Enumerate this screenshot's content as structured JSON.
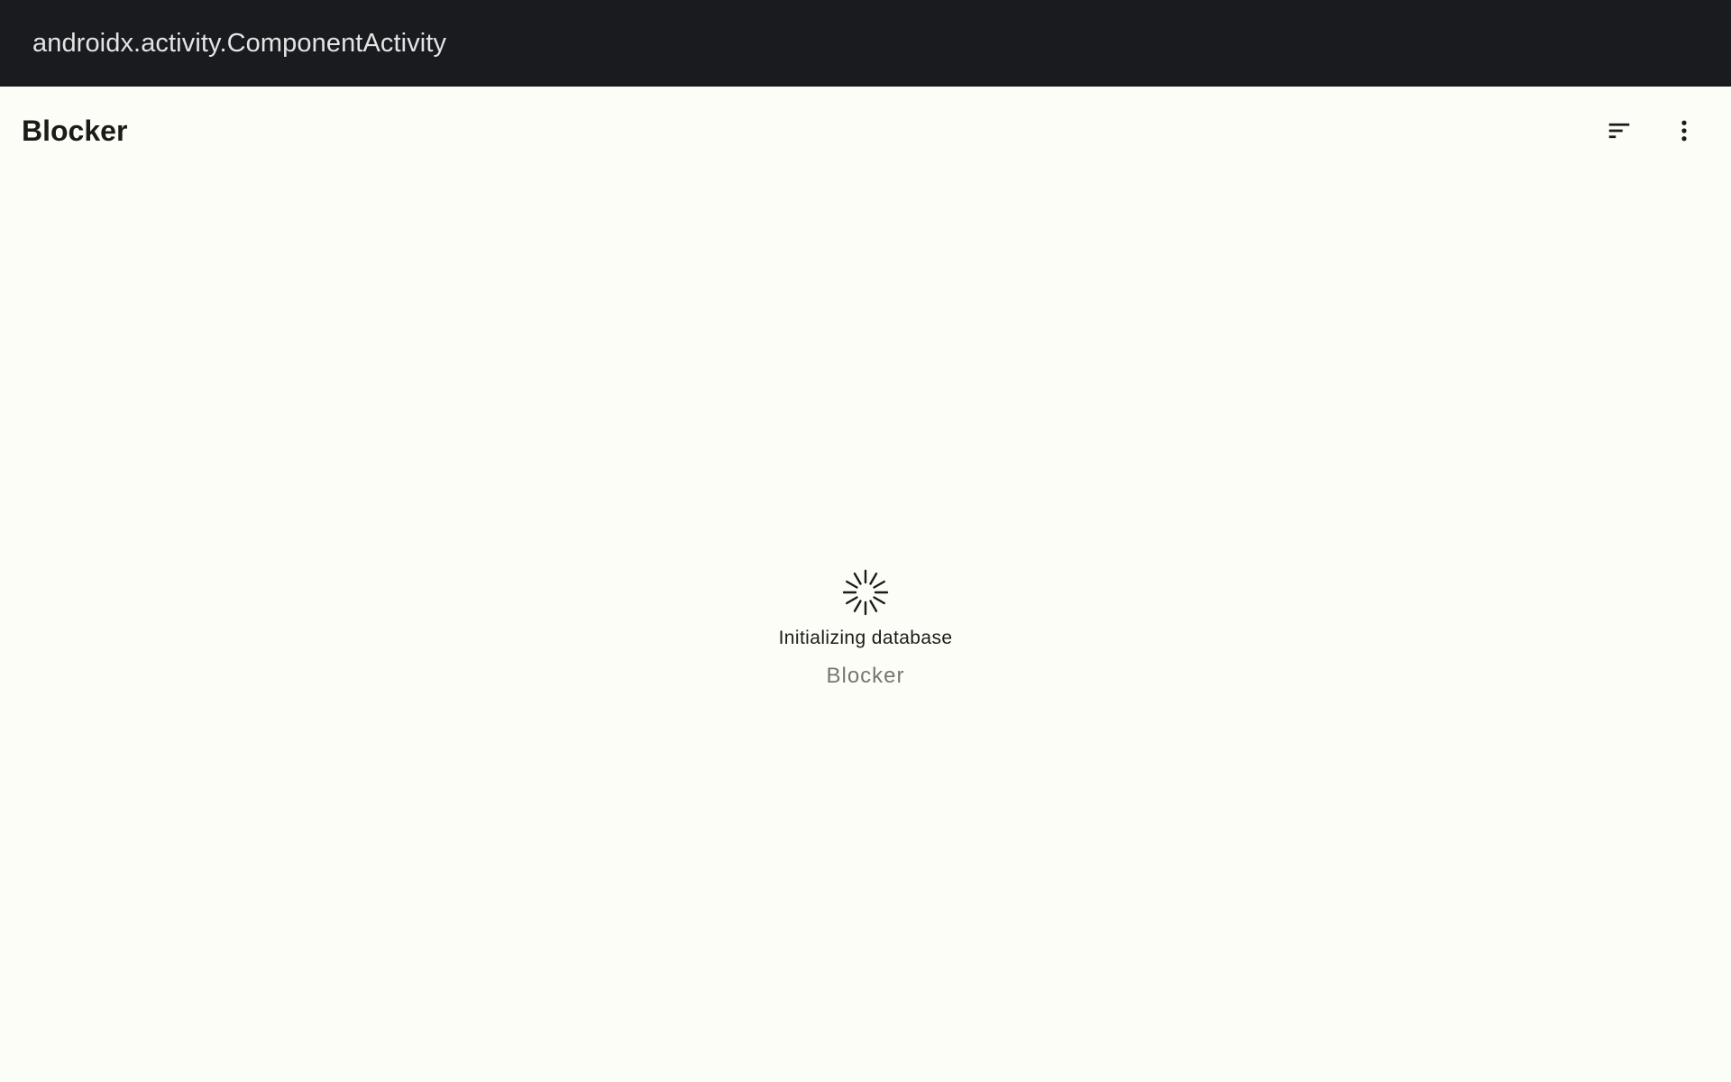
{
  "window": {
    "title": "androidx.activity.ComponentActivity"
  },
  "app_bar": {
    "title": "Blocker",
    "actions": [
      {
        "icon": "sort-icon"
      },
      {
        "icon": "more-vert-icon"
      }
    ]
  },
  "loading": {
    "message": "Initializing database",
    "app_name": "Blocker"
  },
  "colors": {
    "titlebar_bg": "#1a1b1f",
    "background": "#fcfdf7",
    "text_primary": "#1b1c18",
    "text_secondary": "#74776f"
  }
}
